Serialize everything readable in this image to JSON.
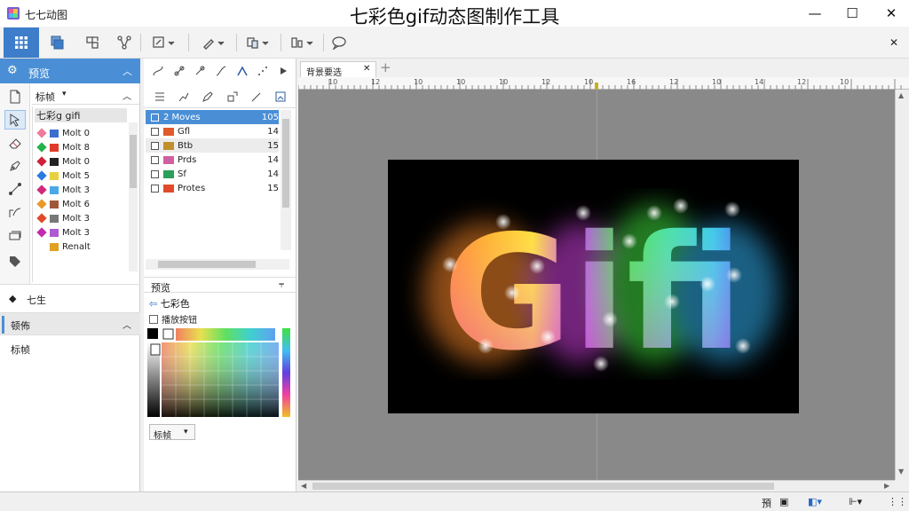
{
  "window": {
    "app_name": "七七动图",
    "title": "七彩色gif动态图制作工具",
    "minimize": "—",
    "maximize": "☐",
    "close": "✕"
  },
  "toolbar": {
    "close_panel": "✕"
  },
  "left_panel": {
    "nav_title": "预览",
    "section_dropdown": "标帧",
    "list_title": "七彩g gifi",
    "layers": [
      {
        "name": "Molt 0",
        "dot": "#f07a9a",
        "swatch": "#3a6fd0"
      },
      {
        "name": "Molt 8",
        "dot": "#25b24a",
        "swatch": "#e03a2a"
      },
      {
        "name": "Molt 0",
        "dot": "#d0203a",
        "swatch": "#222222"
      },
      {
        "name": "Molt 5",
        "dot": "#2a7ae0",
        "swatch": "#e8d040"
      },
      {
        "name": "Molt 3",
        "dot": "#d02a7a",
        "swatch": "#4aa8e8"
      },
      {
        "name": "Molt 6",
        "dot": "#e89a2a",
        "swatch": "#a0583a"
      },
      {
        "name": "Molt 3",
        "dot": "#e04a2a",
        "swatch": "#777777"
      },
      {
        "name": "Molt 3",
        "dot": "#c02ab0",
        "swatch": "#b05ad0"
      },
      {
        "name": "Renalt",
        "dot": "",
        "swatch": "#e0a020"
      }
    ],
    "section2": "七生",
    "section3_title": "顿佈",
    "section3_item": "标帧"
  },
  "mid_panel": {
    "frames": [
      {
        "label": "2 Moves",
        "num": "105",
        "selected": true,
        "swatch": ""
      },
      {
        "label": "Gfl",
        "num": "14",
        "selected": false,
        "swatch": "#e05a2a"
      },
      {
        "label": "Btb",
        "num": "15",
        "selected": false,
        "swatch": "#c0902a"
      },
      {
        "label": "Prds",
        "num": "14",
        "selected": false,
        "swatch": "#d060a0"
      },
      {
        "label": "Sf",
        "num": "14",
        "selected": false,
        "swatch": "#2aa05a"
      },
      {
        "label": "Protes",
        "num": "15",
        "selected": false,
        "swatch": "#e04a2a"
      }
    ],
    "preview_title": "预览",
    "color_link": "七彩色",
    "checkbox_label": "播放按钮",
    "dropdown": "标帧"
  },
  "canvas": {
    "tab_label": "背景要选",
    "tab_close": "✕",
    "tab_add": "+",
    "ruler_ticks": [
      "10",
      "12",
      "10",
      "10",
      "10",
      "12",
      "10",
      "16",
      "12",
      "10",
      "14",
      "12",
      "10"
    ],
    "art_text": "Gifi",
    "colors": {
      "bg": "#000000",
      "workspace": "#898989"
    }
  },
  "statusbar": {
    "label": "預"
  }
}
